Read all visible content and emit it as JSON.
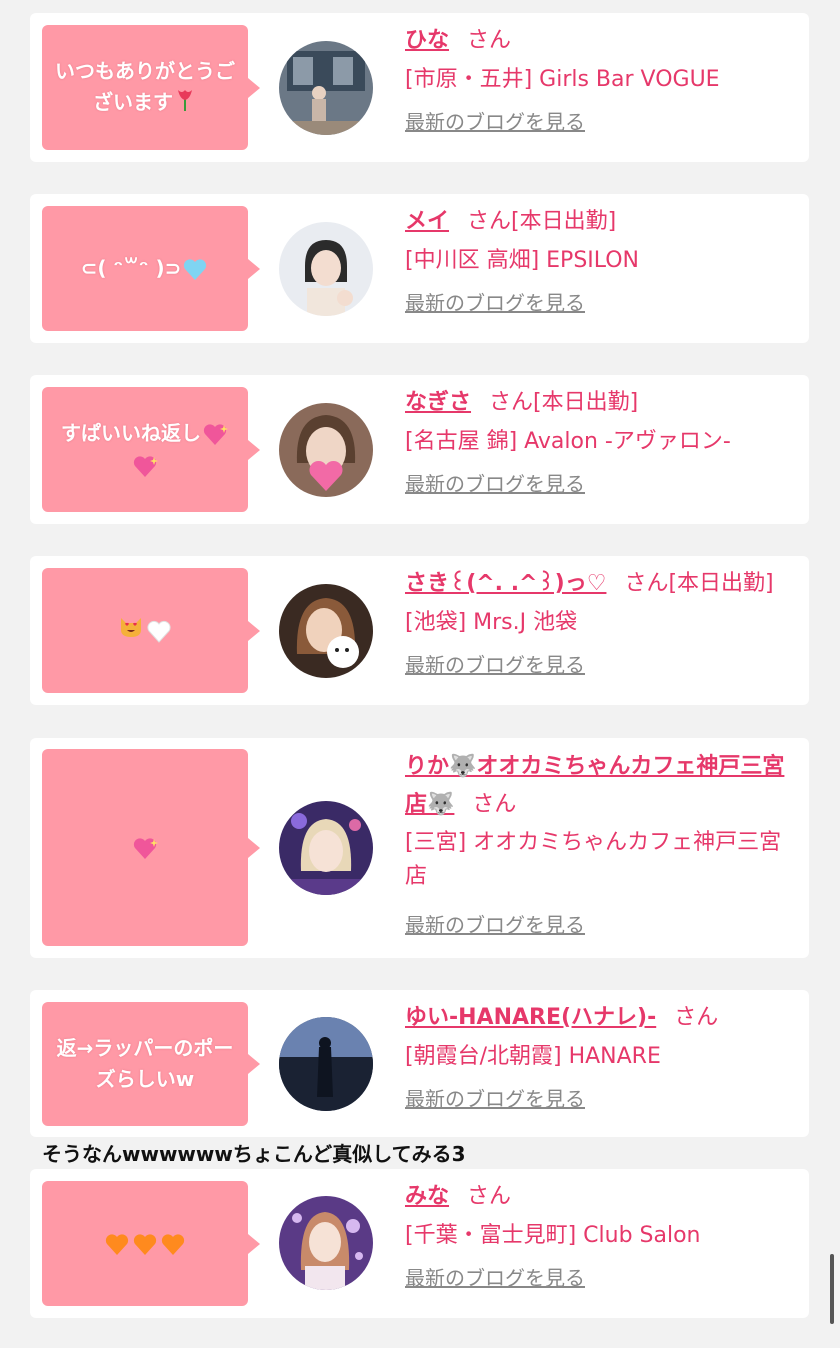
{
  "entries": [
    {
      "message": "いつもありがとうございます",
      "name": "ひな",
      "san": "さん",
      "status": "",
      "shop": "[市原・五井] Girls Bar VOGUE",
      "blog": "最新のブログを見る",
      "avatar_colors": [
        "#5a6a7a",
        "#9aa6b0"
      ]
    },
    {
      "message": "⊂( ᵔ꒳ᵔ )⊃",
      "name": "メイ",
      "san": "さん",
      "status": "[本日出勤]",
      "shop": "[中川区 高畑] EPSILON",
      "blog": "最新のブログを見る",
      "avatar_colors": [
        "#e9ecf1",
        "#2b2b2b"
      ]
    },
    {
      "message": "すぱいいね返し",
      "name": "なぎさ",
      "san": "さん",
      "status": "[本日出勤]",
      "shop": "[名古屋 錦] Avalon -アヴァロン-",
      "blog": "最新のブログを見る",
      "avatar_colors": [
        "#b79a8a",
        "#5a4030"
      ]
    },
    {
      "message": "",
      "name": "さき꒰(^. .^꒱)っ♡",
      "san": "さん",
      "status": "[本日出勤]",
      "shop": "[池袋] Mrs.J 池袋",
      "blog": "最新のブログを見る",
      "avatar_colors": [
        "#3a2a22",
        "#d4a88a"
      ]
    },
    {
      "message": "",
      "name": "りか🐺オオカミちゃんカフェ神戸三宮店🐺",
      "san": "さん",
      "status": "",
      "shop": "[三宮] オオカミちゃんカフェ神戸三宮店",
      "blog": "最新のブログを見る",
      "avatar_colors": [
        "#3a2a66",
        "#c9a4c8"
      ]
    },
    {
      "message": "返→ラッパーのポーズらしいw",
      "name": "ゆい-HANARE(ハナレ)-",
      "san": "さん",
      "status": "",
      "shop": "[朝霞台/北朝霞] HANARE",
      "blog": "最新のブログを見る",
      "avatar_colors": [
        "#3c4f7a",
        "#1a2233"
      ]
    },
    {
      "message": "",
      "name": "みな",
      "san": "さん",
      "status": "",
      "shop": "[千葉・富士見町] Club Salon",
      "blog": "最新のブログを見る",
      "avatar_colors": [
        "#5a3a86",
        "#e8c8d8"
      ]
    }
  ],
  "reply_comment": "そうなんwwwwwwちょこんど真似してみる3",
  "colors": {
    "accent": "#e6386a",
    "bubble": "#ff99a6",
    "card": "#ffffff",
    "background": "#f2f2f2",
    "blog_link": "#888888"
  }
}
